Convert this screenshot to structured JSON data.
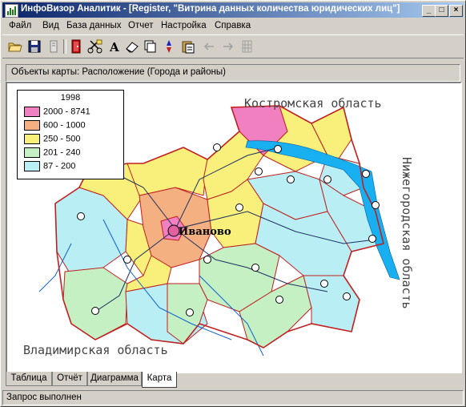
{
  "window": {
    "title": "ИнфоВизор Аналитик - [Register, \"Витрина данных количества юридических лиц\"]",
    "minimize_glyph": "_",
    "maximize_glyph": "□",
    "close_glyph": "×"
  },
  "menu": [
    "Файл",
    "Вид",
    "База данных",
    "Отчет",
    "Настройка",
    "Справка"
  ],
  "toolbar_icons": [
    "open-folder-icon",
    "save-icon",
    "document-icon",
    "exit-door-icon",
    "cut-icon",
    "font-icon",
    "eraser-icon",
    "copy-icon",
    "pin-icon",
    "paste-icon",
    "back-arrow-icon",
    "forward-arrow-icon",
    "grid-icon"
  ],
  "objects_line": "Объекты карты: Расположение (Города и районы)",
  "legend": {
    "year": "1998",
    "items": [
      {
        "label": "2000 - 8741",
        "color": "#f080c0"
      },
      {
        "label": "600 - 1000",
        "color": "#f4b080"
      },
      {
        "label": "250 - 500",
        "color": "#f8f07a"
      },
      {
        "label": "201 - 240",
        "color": "#c4f0c4"
      },
      {
        "label": "87 - 200",
        "color": "#b8eef4"
      }
    ]
  },
  "map": {
    "neighbors": {
      "north": "Костромская область",
      "east": "Нижегородская область",
      "south": "Владимирская область"
    },
    "capital": "Иваново"
  },
  "tabs": [
    {
      "label": "Таблица",
      "active": false
    },
    {
      "label": "Отчёт",
      "active": false
    },
    {
      "label": "Диаграмма",
      "active": false
    },
    {
      "label": "Карта",
      "active": true
    }
  ],
  "status": "Запрос выполнен"
}
